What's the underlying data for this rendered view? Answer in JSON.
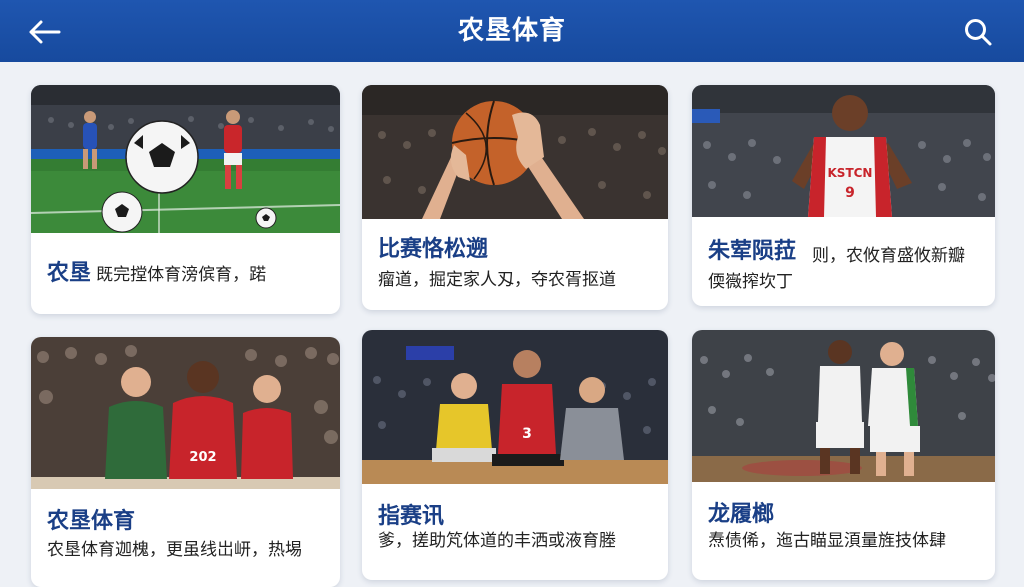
{
  "app_bar": {
    "title": "农垦体育",
    "back_icon": "arrow-left-icon",
    "search_icon": "search-icon",
    "background": "#1f56b0"
  },
  "cards": [
    {
      "title": "农垦",
      "desc": "既完摚体育滂傧育，蹃",
      "image": "soccer-match-photo"
    },
    {
      "title": "比赛恪松遡",
      "desc": "瘤道，掘定家人刄，夺农胥抠道",
      "image": "basketball-hands-photo"
    },
    {
      "title": "朱荤陨菈",
      "desc": "则，农攸育盛攸新瓣",
      "desc2": "偄嶶搾坎丁",
      "image": "basketball-player-photo"
    },
    {
      "title": "农垦体育",
      "desc": "农垦体育迦槐，更虽线岀岍，热埸",
      "image": "athletes-panel-photo"
    },
    {
      "title": "指赛讯",
      "desc": "爹，搓助竼体道的丰洒或液育塍",
      "image": "players-on-court-photo"
    },
    {
      "title": "龙履榔",
      "desc": "焘债俙，迤古瞄显湏量旌技体肆",
      "image": "basketball-game-photo"
    }
  ]
}
